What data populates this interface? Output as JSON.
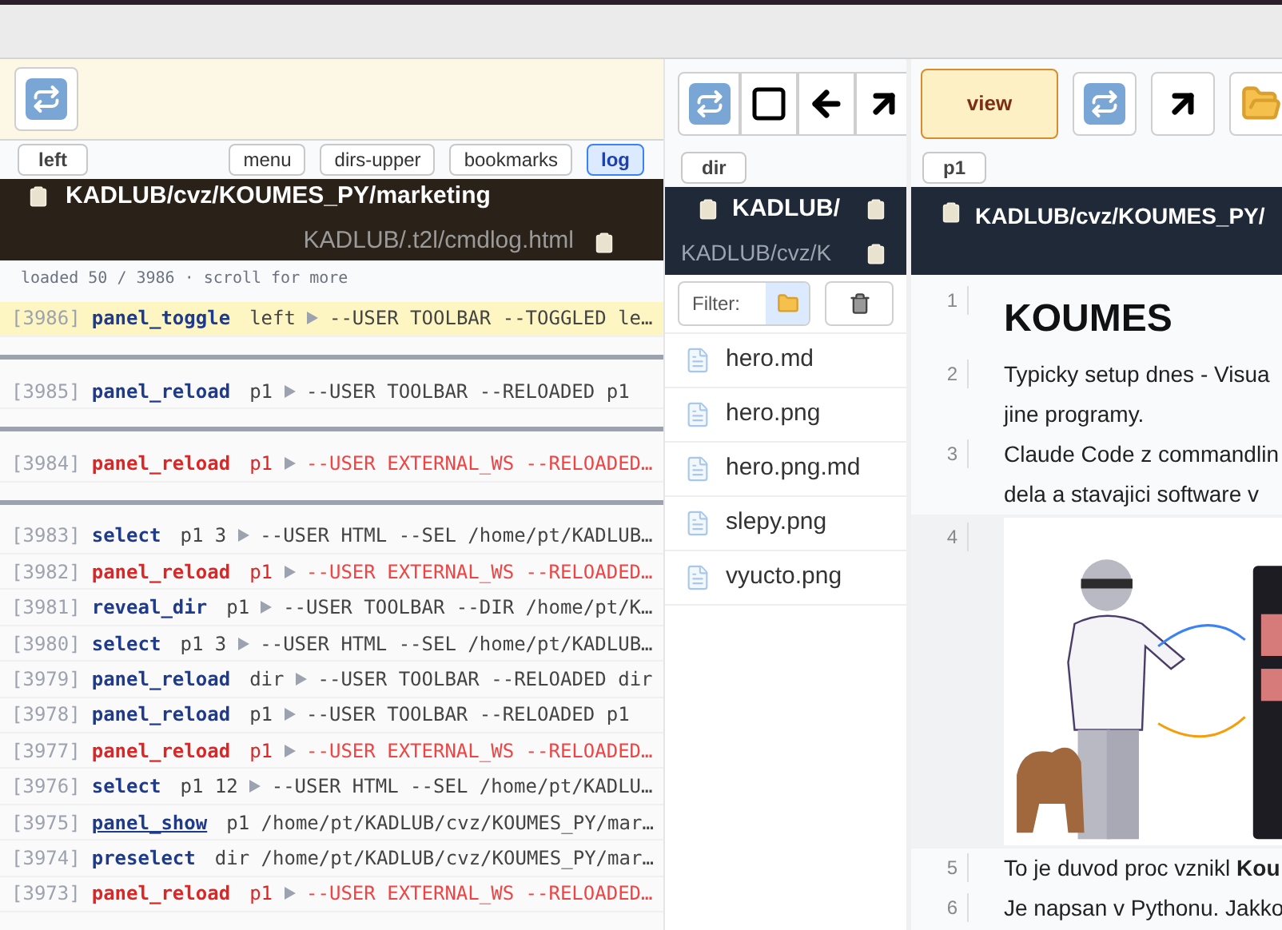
{
  "left_panel": {
    "toolbar_buttons": [
      {
        "kind": "refresh"
      }
    ],
    "name": "left",
    "tabs": [
      {
        "label": "menu",
        "selected": false
      },
      {
        "label": "dirs-upper",
        "selected": false
      },
      {
        "label": "bookmarks",
        "selected": false
      },
      {
        "label": "log",
        "selected": true
      }
    ],
    "header": {
      "title": "KADLUB/cvz/KOUMES_PY/marketing",
      "subtitle": "KADLUB/.t2l/cmdlog.html"
    },
    "status": "loaded 50 / 3986 · scroll for more",
    "log_groups": [
      [
        {
          "id": "[3986]",
          "command": "panel_toggle",
          "args": "left",
          "message": "--USER TOOLBAR --TOGGLED le…",
          "kind": "user",
          "highlighted": true,
          "underlined": false
        }
      ],
      [
        {
          "id": "[3985]",
          "command": "panel_reload",
          "args": "p1",
          "message": "--USER TOOLBAR --RELOADED p1",
          "kind": "user",
          "highlighted": false,
          "underlined": false
        }
      ],
      [
        {
          "id": "[3984]",
          "command": "panel_reload",
          "args": "p1",
          "message": "--USER EXTERNAL_WS --RELOADED…",
          "kind": "external",
          "highlighted": false,
          "underlined": false
        }
      ],
      [
        {
          "id": "[3983]",
          "command": "select",
          "args": "p1 3",
          "message": "--USER HTML --SEL /home/pt/KADLUB…",
          "kind": "user",
          "highlighted": false,
          "underlined": false
        },
        {
          "id": "[3982]",
          "command": "panel_reload",
          "args": "p1",
          "message": "--USER EXTERNAL_WS --RELOADED…",
          "kind": "external",
          "highlighted": false,
          "underlined": false
        },
        {
          "id": "[3981]",
          "command": "reveal_dir",
          "args": "p1",
          "message": "--USER TOOLBAR --DIR /home/pt/K…",
          "kind": "user",
          "highlighted": false,
          "underlined": false
        },
        {
          "id": "[3980]",
          "command": "select",
          "args": "p1 3",
          "message": "--USER HTML --SEL /home/pt/KADLUB…",
          "kind": "user",
          "highlighted": false,
          "underlined": false
        },
        {
          "id": "[3979]",
          "command": "panel_reload",
          "args": "dir",
          "message": "--USER TOOLBAR --RELOADED dir",
          "kind": "user",
          "highlighted": false,
          "underlined": false
        },
        {
          "id": "[3978]",
          "command": "panel_reload",
          "args": "p1",
          "message": "--USER TOOLBAR --RELOADED p1",
          "kind": "user",
          "highlighted": false,
          "underlined": false
        },
        {
          "id": "[3977]",
          "command": "panel_reload",
          "args": "p1",
          "message": "--USER EXTERNAL_WS --RELOADED…",
          "kind": "external",
          "highlighted": false,
          "underlined": false
        },
        {
          "id": "[3976]",
          "command": "select",
          "args": "p1 12",
          "message": "--USER HTML --SEL /home/pt/KADLU…",
          "kind": "user",
          "highlighted": false,
          "underlined": false
        },
        {
          "id": "[3975]",
          "command": "panel_show",
          "args": "p1 /home/pt/KADLUB/cvz/KOUMES_PY/mar…",
          "kind": "user",
          "highlighted": false,
          "underlined": true
        },
        {
          "id": "[3974]",
          "command": "preselect",
          "args": "dir /home/pt/KADLUB/cvz/KOUMES_PY/mar…",
          "kind": "user",
          "highlighted": false,
          "underlined": false
        },
        {
          "id": "[3973]",
          "command": "panel_reload",
          "args": "p1",
          "message": "--USER EXTERNAL_WS --RELOADED…",
          "kind": "external",
          "highlighted": false,
          "underlined": false
        }
      ]
    ]
  },
  "dir_panel": {
    "toolbar_buttons": [
      {
        "kind": "refresh"
      },
      {
        "kind": "square"
      },
      {
        "kind": "arrow-left"
      },
      {
        "kind": "arrow-up-right"
      }
    ],
    "name": "dir",
    "header": {
      "title": "KADLUB/",
      "subtitle": "KADLUB/cvz/K"
    },
    "filter_label": "Filter:",
    "files": [
      "hero.md",
      "hero.png",
      "hero.png.md",
      "slepy.png",
      "vyucto.png"
    ]
  },
  "view_panel": {
    "toolbar_buttons": [
      {
        "kind": "text",
        "label": "view",
        "active": true
      },
      {
        "kind": "refresh",
        "active": false
      },
      {
        "kind": "arrow-up-right",
        "active": false
      },
      {
        "kind": "folder",
        "active": false
      }
    ],
    "name": "p1",
    "header": {
      "title": "KADLUB/cvz/KOUMES_PY/"
    },
    "lines": [
      {
        "number": "1",
        "kind": "heading",
        "text": "KOUMES"
      },
      {
        "number": "2",
        "kind": "paragraph",
        "lines": [
          "Typicky setup dnes - Visua",
          "jine programy."
        ]
      },
      {
        "number": "3",
        "kind": "paragraph",
        "lines": [
          "Claude Code z commandlin",
          "dela a stavajici software v"
        ]
      },
      {
        "number": "4",
        "kind": "picture"
      },
      {
        "number": "5",
        "kind": "paragraph",
        "lines": [
          "To je duvod proc vznikl **Kou**"
        ]
      },
      {
        "number": "6",
        "kind": "paragraph",
        "lines": [
          "Je napsan v Pythonu. Jakko"
        ]
      }
    ]
  }
}
